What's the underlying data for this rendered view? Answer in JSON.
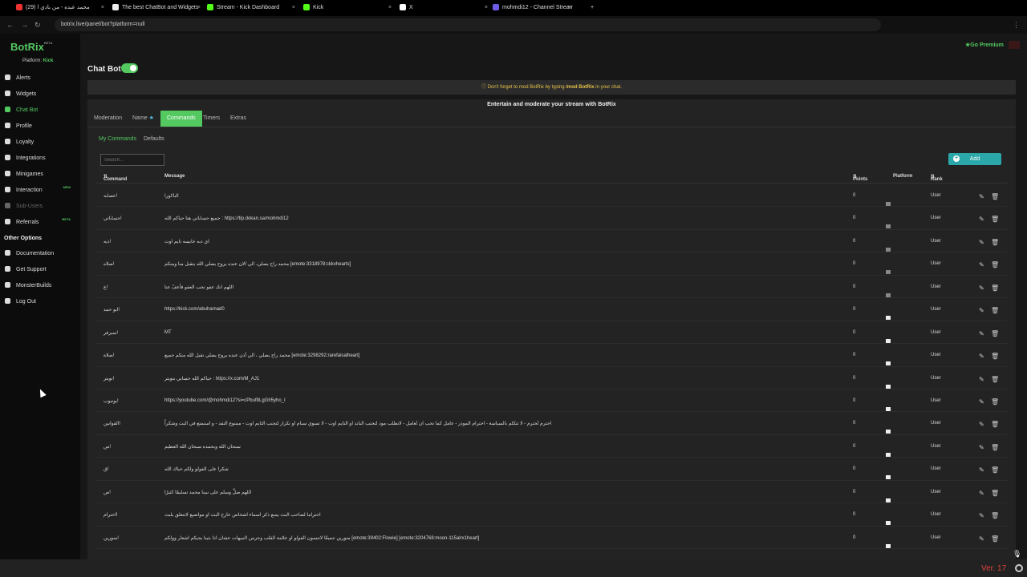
{
  "browser": {
    "tabs": [
      {
        "title": "محمد عبده - من بادي ا (29)",
        "color": "#e33"
      },
      {
        "title": "The best ChatBot and Widgets",
        "color": "#eee"
      },
      {
        "title": "Stream - Kick Dashboard",
        "color": "#53fc18"
      },
      {
        "title": "Kick",
        "color": "#53fc18"
      },
      {
        "title": "X",
        "color": "#fff"
      },
      {
        "title": "mohmdi12 - Channel Stream",
        "color": "#6c5ce7"
      }
    ],
    "url": "botrix.live/panel/bot?platform=null"
  },
  "sidebar": {
    "logo": "BotRix",
    "logo_badge": "BETA",
    "platform_label": "Platform:",
    "platform_value": "Kick",
    "items": [
      {
        "label": "Alerts",
        "icon": "bell-icon"
      },
      {
        "label": "Widgets",
        "icon": "widgets-icon"
      },
      {
        "label": "Chat Bot",
        "icon": "chat-icon"
      },
      {
        "label": "Profile",
        "icon": "profile-icon"
      },
      {
        "label": "Loyalty",
        "icon": "loyalty-icon"
      },
      {
        "label": "Integrations",
        "icon": "integrations-icon"
      },
      {
        "label": "Minigames",
        "icon": "minigames-icon"
      },
      {
        "label": "Interaction",
        "icon": "interaction-icon",
        "badge": "NEW"
      },
      {
        "label": "Sub-Users",
        "icon": "sub-users-icon"
      },
      {
        "label": "Referrals",
        "icon": "referrals-icon",
        "badge": "BETA"
      }
    ],
    "other_title": "Other Options",
    "other_items": [
      {
        "label": "Documentation",
        "icon": "docs-icon"
      },
      {
        "label": "Get Support",
        "icon": "support-icon"
      },
      {
        "label": "MonsterBuilds",
        "icon": "monster-icon"
      },
      {
        "label": "Log Out",
        "icon": "logout-icon"
      }
    ]
  },
  "header": {
    "title": "Chat Bot",
    "go_premium": "Go Premium"
  },
  "notice": {
    "pre": "Don't forget to mod BotRix by typing",
    "cmd": "/mod BotRix",
    "post": "in your chat."
  },
  "panel": {
    "tagline": "Entertain and moderate your stream with BotRix",
    "tabs": [
      "Moderation",
      "Name",
      "Commands",
      "Timers",
      "Extras"
    ],
    "subtabs": [
      "My Commands",
      "Defaults"
    ],
    "search_placeholder": "Search...",
    "add_label": "Add",
    "columns": {
      "command": "Command",
      "message": "Message",
      "points": "Points",
      "platform": "Platform",
      "rank": "Rank"
    },
    "rows": [
      {
        "command": "!عصابه",
        "message": "الباكورا",
        "points": "0",
        "rank": "User",
        "all": false
      },
      {
        "command": "!حساباتي",
        "message": "جميع حساباتي هنا حياكم الله : https://tip.dokan.sa/mohmdi12",
        "points": "0",
        "rank": "User",
        "all": false
      },
      {
        "command": "!ذبه",
        "message": "اي ذبه خايسه تايم اوت",
        "points": "0",
        "rank": "User",
        "all": false
      },
      {
        "command": "!صلاه",
        "message": "محمد راح يصلي، الي الان عنده يروح يصلي الله يتقبل منا ومنكم [emote:3318978:ckkvhearts]",
        "points": "0",
        "rank": "User",
        "all": false
      },
      {
        "command": "!ع",
        "message": "اللهم انك عفو تحب العفو فأعفُ عنا",
        "points": "0",
        "rank": "User",
        "all": false
      },
      {
        "command": "!ابو حمد",
        "message": "https://kick.com/abuhamad0",
        "points": "0",
        "rank": "User",
        "all": true
      },
      {
        "command": "!سيرفر",
        "message": "MT",
        "points": "0",
        "rank": "User",
        "all": true
      },
      {
        "command": "!صلاة",
        "message": "محمد راح يصلي ، الي أذن عنده يروح يصلي تقبل الله منكم جميع [emote:3298292:rarefaisalheart]",
        "points": "0",
        "rank": "User",
        "all": true
      },
      {
        "command": "!تويتر",
        "message": "حياكم الله حسابي بتويتر : https://x.com/M_AJ1",
        "points": "0",
        "rank": "User",
        "all": true
      },
      {
        "command": "!يوتيوب",
        "message": "https://youtube.com/@mohmdi12?si=cPbuf8LgGh5yho_I",
        "points": "0",
        "rank": "User",
        "all": true
      },
      {
        "command": "!القوانين",
        "message": "احترم تُحترم - لا تتكلم بالسياسة - احترام المودز - عامل كما تحب ان تُعامل - لاتطلب مود لتجنب الباند او التايم اوت - لا تسوي سبام او تكرار لتجنب التايم اوت - ممنوع النقد - و استمتع في البث وشكراً",
        "points": "0",
        "rank": "User",
        "all": true
      },
      {
        "command": "!س",
        "message": "سبحان الله وبحمده سبحان الله العظيم",
        "points": "0",
        "rank": "User",
        "all": true
      },
      {
        "command": "!ق",
        "message": "شكرا على الفولو ولكم حياك الله",
        "points": "0",
        "rank": "User",
        "all": true
      },
      {
        "command": "!ص",
        "message": "اللهم صلِّ وسلم على نبينا محمد تسليمًا كثيرًا",
        "points": "0",
        "rank": "User",
        "all": true
      },
      {
        "command": "!احترام",
        "message": "احتراما لصاحب البث يمنع ذكر اسماء اشخاص خارج البث او مواضيع لاتتعلق بلبث",
        "points": "0",
        "rank": "User",
        "all": true
      },
      {
        "command": "!منورين",
        "message": "منورين جميعًا لاتنسون الفولو او علامة القلب وجرس النبيهات عشان اذا بثينا يجيكم اشعار وولكم [emote:39402:Flowie] [emote:3204768:moon-115alrx1heart]",
        "points": "0",
        "rank": "User",
        "all": true
      }
    ]
  },
  "footer": {
    "version": "Ver. 17"
  },
  "colors": {
    "accent": "#53c95f",
    "add_button": "#2aa7a8",
    "notice": "#e8c44a",
    "version": "#e0453a"
  }
}
